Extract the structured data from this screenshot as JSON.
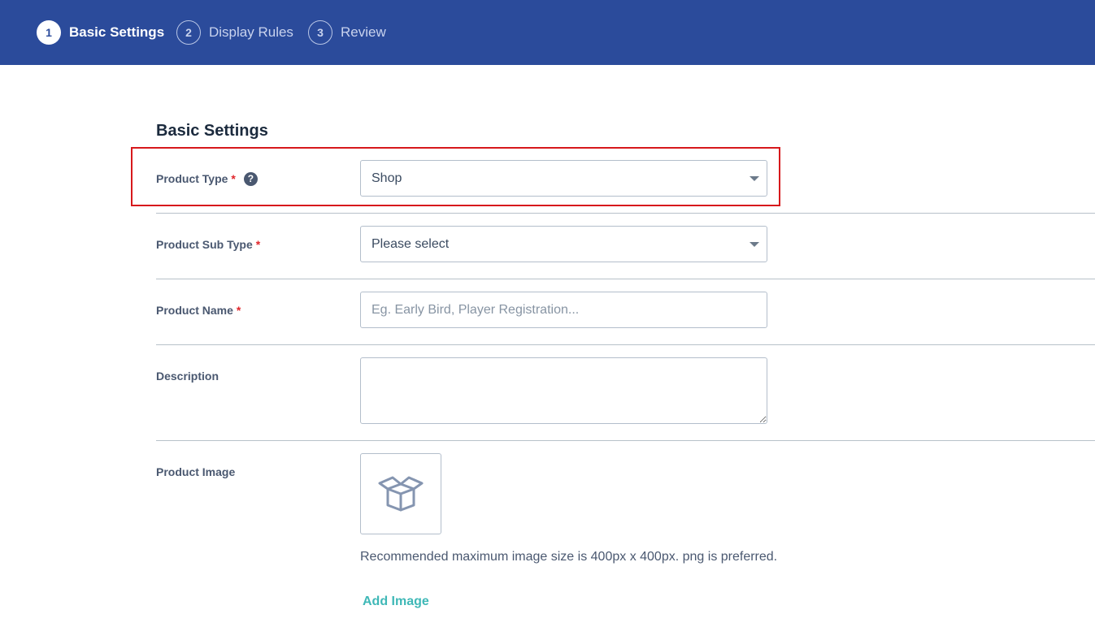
{
  "steps": [
    {
      "number": "1",
      "label": "Basic Settings",
      "state": "active"
    },
    {
      "number": "2",
      "label": "Display Rules",
      "state": "inactive"
    },
    {
      "number": "3",
      "label": "Review",
      "state": "inactive"
    }
  ],
  "section_title": "Basic Settings",
  "form": {
    "product_type": {
      "label": "Product Type",
      "required": "*",
      "help_icon": "question-circle-icon",
      "value": "Shop"
    },
    "product_sub_type": {
      "label": "Product Sub Type",
      "required": "*",
      "value": "Please select"
    },
    "product_name": {
      "label": "Product Name",
      "required": "*",
      "placeholder": "Eg. Early Bird, Player Registration..."
    },
    "description": {
      "label": "Description"
    },
    "product_image": {
      "label": "Product Image",
      "icon": "box-icon",
      "hint": "Recommended maximum image size is 400px x 400px. png is preferred.",
      "add_label": "Add Image"
    }
  },
  "colors": {
    "header_bg": "#2b4b9b",
    "required": "#e0262b",
    "highlight": "#d7191c",
    "link": "#3fb8b7"
  }
}
